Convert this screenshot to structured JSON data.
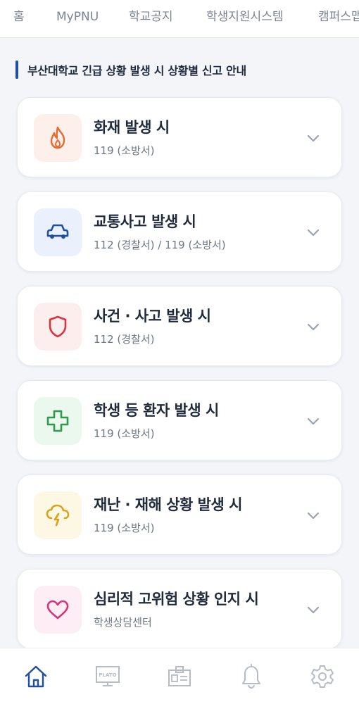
{
  "top_nav": {
    "tabs": [
      "홈",
      "MyPNU",
      "학교공지",
      "학생지원시스템",
      "캠퍼스맵"
    ]
  },
  "section": {
    "title": "부산대학교 긴급 상황 발생 시 상황별 신고 안내"
  },
  "cards": [
    {
      "title": "화재 발생 시",
      "subtitle": "119 (소방서)",
      "icon": "fire-icon",
      "color": "#e8692e",
      "bg": "#fdf0ea"
    },
    {
      "title": "교통사고 발생 시",
      "subtitle": "112 (경찰서) / 119 (소방서)",
      "icon": "car-icon",
      "color": "#1f4fa0",
      "bg": "#eaf1fd"
    },
    {
      "title": "사건 · 사고 발생 시",
      "subtitle": "112 (경찰서)",
      "icon": "shield-icon",
      "color": "#d8343f",
      "bg": "#fdeeee"
    },
    {
      "title": "학생 등 환자 발생 시",
      "subtitle": "119 (소방서)",
      "icon": "medical-cross-icon",
      "color": "#2f9a4c",
      "bg": "#ebf8ee"
    },
    {
      "title": "재난 · 재해 상황 발생 시",
      "subtitle": "119 (소방서)",
      "icon": "storm-icon",
      "color": "#d9a21a",
      "bg": "#fdf8e4"
    },
    {
      "title": "심리적 고위험 상황 인지 시",
      "subtitle": "학생상담센터",
      "icon": "heart-icon",
      "color": "#d6337a",
      "bg": "#fdeef5"
    }
  ],
  "bottom_nav": {
    "items": [
      "home-icon",
      "plato-icon",
      "id-card-icon",
      "bell-icon",
      "settings-icon"
    ],
    "plato_label": "PLATO",
    "active_color": "#1f4fa0",
    "inactive_color": "#b5bcc6"
  }
}
